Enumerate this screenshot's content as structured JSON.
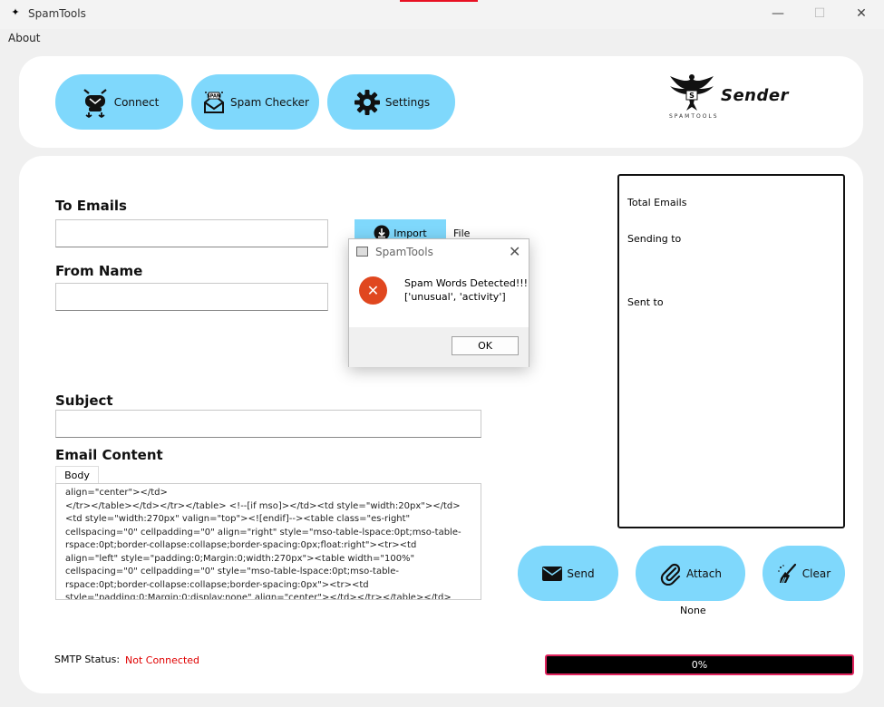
{
  "window": {
    "title": "SpamTools",
    "minimize": "—",
    "maximize": "☐",
    "close": "✕"
  },
  "menu": {
    "about": "About"
  },
  "toolbar": {
    "connect_label": "Connect",
    "spam_checker_label": "Spam Checker",
    "settings_label": "Settings"
  },
  "logo": {
    "word": "Sender",
    "sub": "SPAMTOOLS"
  },
  "form": {
    "to_emails_label": "To Emails",
    "to_emails_value": "",
    "import_label": "Import",
    "file_label": "File",
    "from_name_label": "From Name",
    "from_name_value": "",
    "subject_label": "Subject",
    "subject_value": "",
    "email_content_label": "Email Content",
    "body_tab": "Body",
    "body_text": "align=\"center\"></td>\n</tr></table></td></tr></table> <!--[if mso]></td><td style=\"width:20px\"></td><td style=\"width:270px\" valign=\"top\"><![endif]--><table class=\"es-right\" cellspacing=\"0\" cellpadding=\"0\" align=\"right\" style=\"mso-table-lspace:0pt;mso-table-rspace:0pt;border-collapse:collapse;border-spacing:0px;float:right\"><tr><td align=\"left\" style=\"padding:0;Margin:0;width:270px\"><table width=\"100%\" cellspacing=\"0\" cellpadding=\"0\" style=\"mso-table-lspace:0pt;mso-table-rspace:0pt;border-collapse:collapse;border-spacing:0px\"><tr><td style=\"padding:0;Margin:0;display:none\" align=\"center\"></td></tr></table></td></tr></table> <!--[if mso]></td></tr></table><![endif]--></td></tr></table></td></tr></table></td></tr></table></td></tr>"
  },
  "status_panel": {
    "total_emails": "Total Emails",
    "sending_to": "Sending to",
    "sent_to": "Sent to"
  },
  "actions": {
    "send_label": "Send",
    "attach_label": "Attach",
    "clear_label": "Clear",
    "attachment_value": "None"
  },
  "smtp": {
    "label": "SMTP Status:",
    "value": "Not Connected"
  },
  "progress": {
    "value": 0,
    "text": "0%"
  },
  "dialog": {
    "title": "SpamTools",
    "close": "✕",
    "message_line1": "Spam Words Detected!!!",
    "message_line2": "['unusual', 'activity']",
    "ok_label": "OK"
  },
  "colors": {
    "button": "#7fd8fc",
    "error": "#e0471f",
    "status_red": "#e00000",
    "progress_border": "#e0245e"
  }
}
